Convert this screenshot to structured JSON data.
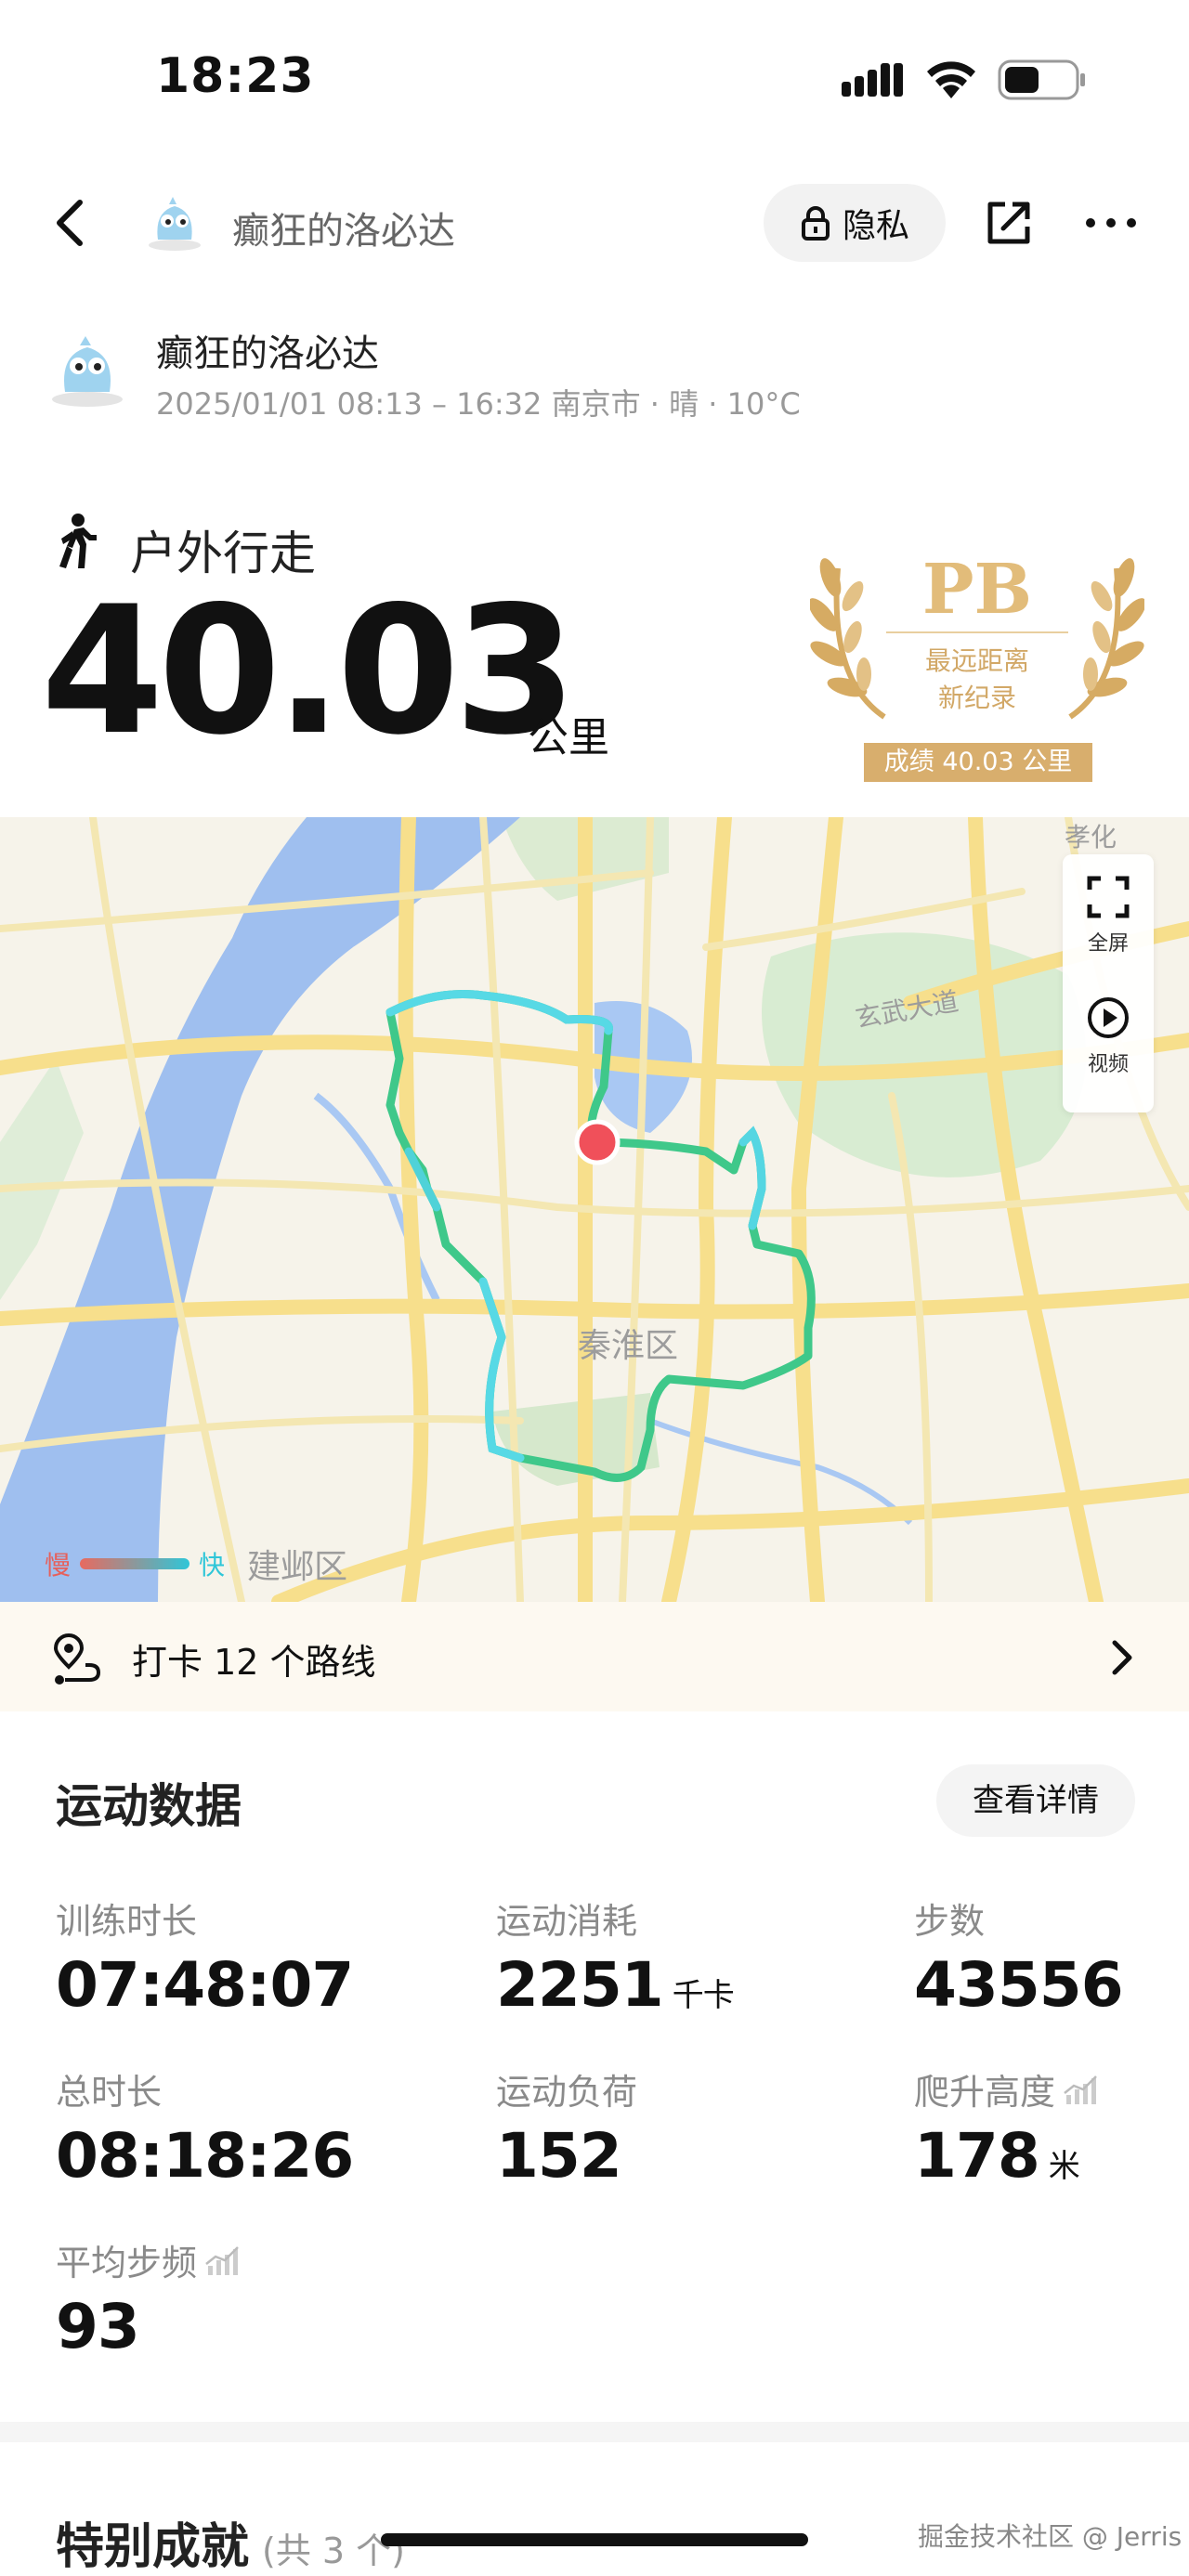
{
  "status_bar": {
    "time": "18:23"
  },
  "nav": {
    "title": "癫狂的洛必达",
    "privacy_label": "隐私"
  },
  "user": {
    "name": "癫狂的洛必达",
    "meta": "2025/01/01 08:13 – 16:32 南京市 · 晴 · 10°C"
  },
  "activity": {
    "type": "户外行走",
    "distance": "40.03",
    "unit": "公里"
  },
  "pb_badge": {
    "title": "PB",
    "desc_line1": "最远距离",
    "desc_line2": "新纪录",
    "record": "成绩 40.03 公里"
  },
  "map": {
    "controls": {
      "fullscreen": "全屏",
      "video": "视频"
    },
    "legend": {
      "slow": "慢",
      "fast": "快"
    },
    "labels": {
      "district_qinhuai": "秦淮区",
      "district_jianye": "建邺区",
      "road_xuanwu": "玄武大道",
      "corner": "孝化"
    },
    "colors": {
      "route_slow": "#3dbf6c",
      "route_fast": "#4fd8e0",
      "marker": "#f0505a"
    }
  },
  "checkin": {
    "text": "打卡 12 个路线"
  },
  "sports_data": {
    "title": "运动数据",
    "detail_button": "查看详情",
    "stats": [
      {
        "label": "训练时长",
        "value": "07:48:07",
        "unit": ""
      },
      {
        "label": "运动消耗",
        "value": "2251",
        "unit": "千卡"
      },
      {
        "label": "步数",
        "value": "43556",
        "unit": ""
      },
      {
        "label": "总时长",
        "value": "08:18:26",
        "unit": ""
      },
      {
        "label": "运动负荷",
        "value": "152",
        "unit": ""
      },
      {
        "label": "爬升高度",
        "value": "178",
        "unit": "米"
      },
      {
        "label": "平均步频",
        "value": "93",
        "unit": ""
      }
    ]
  },
  "achievements": {
    "title": "特别成就",
    "count": "(共 3 个)"
  },
  "watermark": "掘金技术社区 @ Jerris"
}
